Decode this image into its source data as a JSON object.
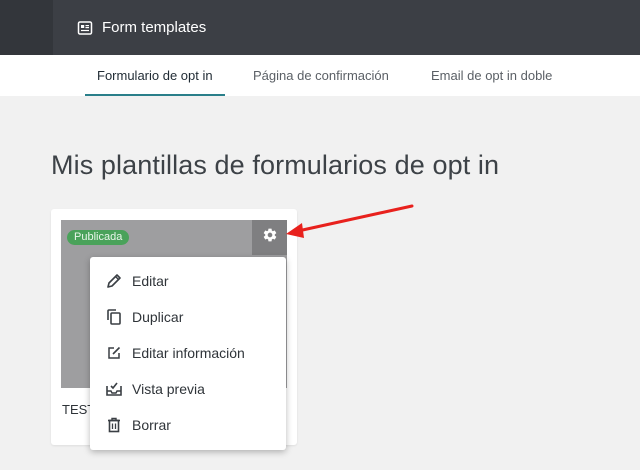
{
  "header": {
    "title": "Form templates"
  },
  "tabs": [
    {
      "label": "Formulario de opt in",
      "active": true
    },
    {
      "label": "Página de confirmación",
      "active": false
    },
    {
      "label": "Email de opt in doble",
      "active": false
    }
  ],
  "page": {
    "title": "Mis plantillas de formularios de opt in"
  },
  "card": {
    "status_badge": "Publicada",
    "name": "TEST",
    "settings_icon": "gear-icon"
  },
  "menu": {
    "items": [
      {
        "label": "Editar",
        "icon": "pencil-icon"
      },
      {
        "label": "Duplicar",
        "icon": "copy-icon"
      },
      {
        "label": "Editar información",
        "icon": "edit-info-icon"
      },
      {
        "label": "Vista previa",
        "icon": "preview-icon"
      },
      {
        "label": "Borrar",
        "icon": "trash-icon"
      }
    ]
  },
  "colors": {
    "topbar": "#3c3f45",
    "accent": "#2a7f8a",
    "badge": "#4aa25a",
    "arrow": "#e8211d"
  }
}
